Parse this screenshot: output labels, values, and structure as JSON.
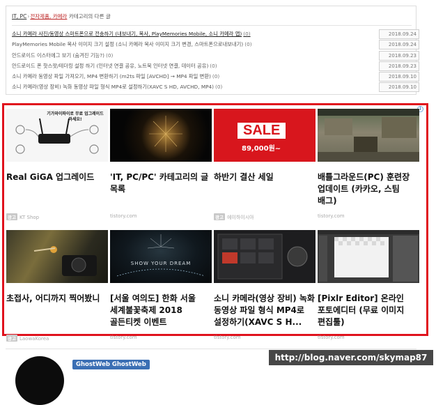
{
  "breadcrumb": {
    "category": "IT, PC",
    "subcategory": "전자제품, 카메라",
    "suffix": " 카테고리의 다른 글"
  },
  "related_posts": [
    {
      "title": "소니 카메라 사진/동영상 스마트폰으로 전송하기 (내보내기, 복사, PlayMemories Mobile, 소니 카메라 앱)",
      "count": "(0)",
      "date": "2018.09.24"
    },
    {
      "title": "PlayMemories Mobile 복사 이미지 크기 설정 (소니 카메라 복사 이미지 크기 변경, 스마트폰으로내보내기)",
      "count": "(0)",
      "date": "2018.09.24"
    },
    {
      "title": "안드로이드 이스터에그 보기 (숨겨진 기능?)",
      "count": "(0)",
      "date": "2018.09.23"
    },
    {
      "title": "안드로이드 폰 핫스팟/테더링 설정 하기 (인터넷 연결 공유, 노트북 인터넷 연결, 데이터 공유)",
      "count": "(0)",
      "date": "2018.09.23"
    },
    {
      "title": "소니 카메라 동영상 파일 가져오기, MP4 변환하기 (m2ts 파일 [AVCHD] → MP4 파일 변환)",
      "count": "(0)",
      "date": "2018.09.10"
    },
    {
      "title": "소니 카메라(영상 장비) 녹화 동영상 파일 형식 MP4로 설정하기(XAVC S HD, AVCHD, MP4)",
      "count": "(0)",
      "date": "2018.09.10"
    }
  ],
  "ads": {
    "info_icon": "info-icon",
    "badge": "광고",
    "cards": [
      {
        "headline": "Real GiGA 업그레이드",
        "source": "KT Shop",
        "is_ad": true,
        "thumb_text": "기가와이파이로 무료 업그레이드 하세요!"
      },
      {
        "headline": "'IT, PC/PC' 카테고리의 글 목록",
        "source": "tistory.com",
        "is_ad": false,
        "thumb_text": ""
      },
      {
        "headline": "하반기 결산 세일",
        "source": "에이하이시아",
        "is_ad": true,
        "thumb_text": "SALE",
        "thumb_price": "89,000원~"
      },
      {
        "headline": "배틀그라운드(PC) 훈련장 업데이트 (카카오, 스팀 배그)",
        "source": "tistory.com",
        "is_ad": false,
        "thumb_text": ""
      },
      {
        "headline": "초접사, 어디까지 찍어봤니",
        "source": "LaowaKorea",
        "is_ad": true,
        "thumb_text": ""
      },
      {
        "headline": "[서울 여의도] 한화 서울 세계불꽃축제 2018 골든티켓 이벤트",
        "source": "tistory.com",
        "is_ad": false,
        "thumb_text": "SHOW YOUR DREAM"
      },
      {
        "headline": "소니 카메라(영상 장비) 녹화 동영상 파일 형식 MP4로 설정하기(XAVC S H...",
        "source": "tistory.com",
        "is_ad": false,
        "thumb_text": ""
      },
      {
        "headline": "[Pixlr Editor] 온라인 포토에디터 (무료 이미지 편집툴)",
        "source": "tistory.com",
        "is_ad": false,
        "thumb_text": ""
      }
    ]
  },
  "author": {
    "name": "GhostWeb GhostWeb"
  },
  "watermark": "http://blog.naver.com/skymap87",
  "colors": {
    "ad_border": "#e0121d",
    "author_tag": "#3b6fb4",
    "sale_red": "#d8161d"
  }
}
